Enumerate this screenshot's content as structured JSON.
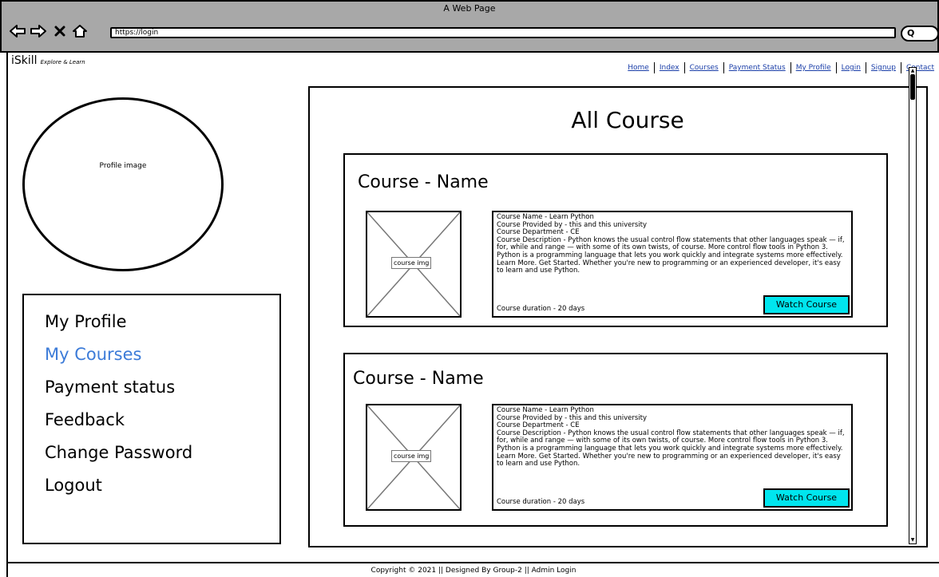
{
  "window": {
    "title": "A Web Page"
  },
  "browser": {
    "url": "https://login",
    "search_icon_glyph": "Q",
    "icons": [
      "back-arrow-icon",
      "forward-arrow-icon",
      "close-icon",
      "home-icon"
    ]
  },
  "brand": {
    "name": "iSkill",
    "tagline": "Explore & Learn"
  },
  "topnav": [
    "Home",
    "Index",
    "Courses",
    "Payment Status",
    "My Profile",
    "Login",
    "Signup",
    "Contact"
  ],
  "profile": {
    "image_label": "Profile image"
  },
  "side_menu": {
    "items": [
      "My Profile",
      "My Courses",
      "Payment status",
      "Feedback",
      "Change Password",
      "Logout"
    ],
    "active_index": 1,
    "active_color": "#3c7bd8"
  },
  "main": {
    "title": "All Course"
  },
  "courses": [
    {
      "heading": "Course - Name",
      "image_label": "course img",
      "name_line": "Course Name  - Learn Python",
      "provider_line": "Course Provided by - this and this university",
      "department_line": "Course Department - CE",
      "description_line": "Course Description - Python knows the usual control flow statements that other languages speak — if, for, while and range — with some of its own twists, of course. More control flow tools in Python 3. Python is a programming language that lets you work quickly and integrate systems more effectively. Learn More. Get Started. Whether you're new to programming or an experienced developer, it's easy to learn and use Python.",
      "duration_line": "Course duration - 20 days",
      "button": "Watch Course"
    },
    {
      "heading": "Course - Name",
      "image_label": "course img",
      "name_line": "Course Name  - Learn Python",
      "provider_line": "Course Provided by - this and this university",
      "department_line": "Course Department - CE",
      "description_line": "Course Description - Python knows the usual control flow statements that other languages speak — if, for, while and range — with some of its own twists, of course. More control flow tools in Python 3. Python is a programming language that lets you work quickly and integrate systems more effectively. Learn More. Get Started. Whether you're new to programming or an experienced developer, it's easy to learn and use Python.",
      "duration_line": "Course duration - 20 days",
      "button": "Watch Course"
    }
  ],
  "colors": {
    "watch_button": "#00e5ee",
    "link": "#1a3ea8",
    "chrome": "#a8a8a8"
  },
  "footer": {
    "text": "Copyright © 2021 || Designed By Group-2 || Admin Login"
  }
}
